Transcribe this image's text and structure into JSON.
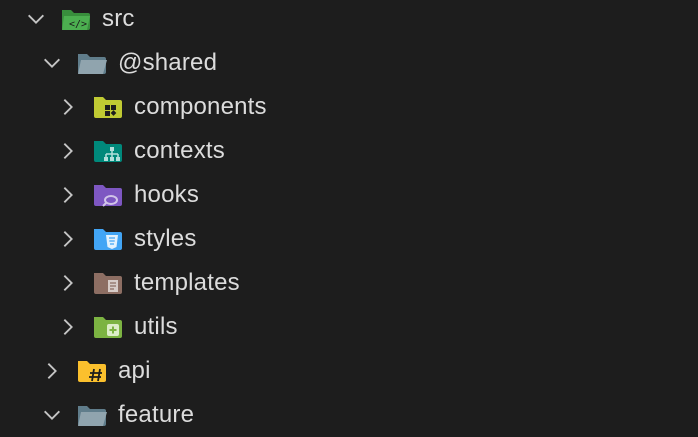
{
  "tree": {
    "items": [
      {
        "label": "src",
        "expanded": true,
        "depth": 0,
        "icon": "folder-src-open-icon",
        "color": "#4caf50"
      },
      {
        "label": "@shared",
        "expanded": true,
        "depth": 1,
        "icon": "folder-open-icon",
        "color": "#90a4ae"
      },
      {
        "label": "components",
        "expanded": false,
        "depth": 2,
        "icon": "folder-components-icon",
        "color": "#c0ca33"
      },
      {
        "label": "contexts",
        "expanded": false,
        "depth": 2,
        "icon": "folder-contexts-icon",
        "color": "#26a69a"
      },
      {
        "label": "hooks",
        "expanded": false,
        "depth": 2,
        "icon": "folder-hooks-icon",
        "color": "#7e57c2"
      },
      {
        "label": "styles",
        "expanded": false,
        "depth": 2,
        "icon": "folder-styles-icon",
        "color": "#42a5f5"
      },
      {
        "label": "templates",
        "expanded": false,
        "depth": 2,
        "icon": "folder-templates-icon",
        "color": "#8d6e63"
      },
      {
        "label": "utils",
        "expanded": false,
        "depth": 2,
        "icon": "folder-utils-icon",
        "color": "#7cb342"
      },
      {
        "label": "api",
        "expanded": false,
        "depth": 1,
        "icon": "folder-api-icon",
        "color": "#fbc02d"
      },
      {
        "label": "feature",
        "expanded": true,
        "depth": 1,
        "icon": "folder-open-icon",
        "color": "#90a4ae"
      }
    ]
  }
}
